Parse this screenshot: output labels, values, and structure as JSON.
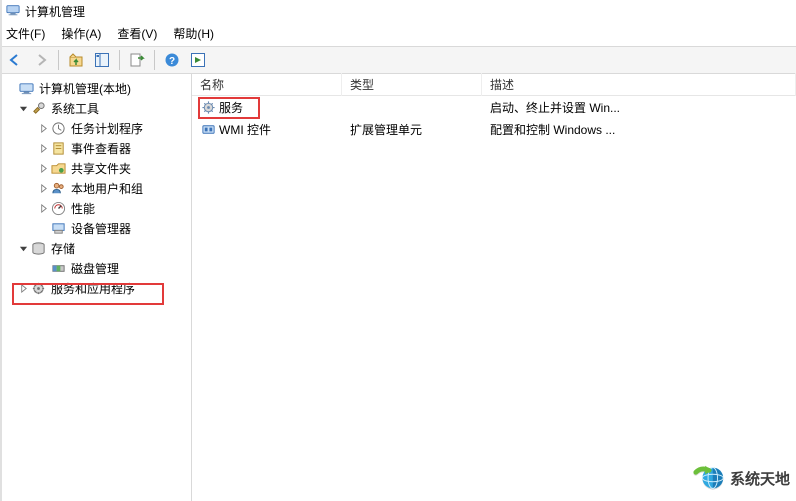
{
  "window": {
    "title": "计算机管理"
  },
  "menu": {
    "file": "文件(F)",
    "action": "操作(A)",
    "view": "查看(V)",
    "help": "帮助(H)"
  },
  "tree": {
    "root": "计算机管理(本地)",
    "system_tools": "系统工具",
    "task_scheduler": "任务计划程序",
    "event_viewer": "事件查看器",
    "shared_folders": "共享文件夹",
    "local_users": "本地用户和组",
    "performance": "性能",
    "device_manager": "设备管理器",
    "storage": "存储",
    "disk_management": "磁盘管理",
    "services_apps": "服务和应用程序"
  },
  "list": {
    "columns": {
      "name": "名称",
      "type": "类型",
      "desc": "描述"
    },
    "rows": [
      {
        "name": "服务",
        "type": "",
        "desc": "启动、终止并设置 Win..."
      },
      {
        "name": "WMI 控件",
        "type": "扩展管理单元",
        "desc": "配置和控制 Windows ..."
      }
    ]
  },
  "watermark": {
    "text": "系统天地"
  }
}
